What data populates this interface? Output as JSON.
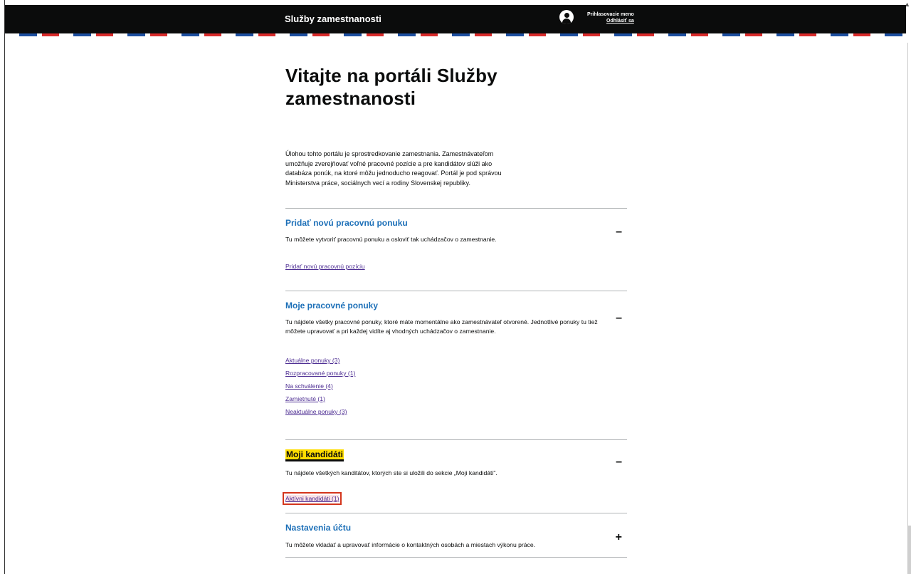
{
  "header": {
    "brand": "Služby zamestnanosti",
    "user_name": "Prihlasovacie meno",
    "logout": "Odhlásiť sa"
  },
  "main": {
    "title": "Vitajte na portáli Služby zamestnanosti",
    "intro": "Úlohou tohto portálu je sprostredkovanie zamestnania. Zamestnávateľom umožňuje zverejňovať voľné pracovné pozície a pre kandidátov slúži ako databáza ponúk, na ktoré môžu jednoducho reagovať. Portál je pod správou Ministerstva práce, sociálnych vecí a rodiny Slovenskej republiky."
  },
  "sections": [
    {
      "title": "Pridať novú pracovnú ponuku",
      "toggle": "–",
      "description": "Tu môžete vytvoriť pracovnú ponuku a osloviť tak uchádzačov o zamestnanie.",
      "links": [
        "Pridať novú pracovnú pozíciu"
      ]
    },
    {
      "title": "Moje pracovné ponuky",
      "toggle": "–",
      "description": "Tu nájdete všetky pracovné ponuky, ktoré máte momentálne ako zamestnávateľ otvorené. Jednotlivé ponuky tu tiež môžete upravovať a pri každej vidíte aj vhodných uchádzačov o zamestnanie.",
      "links": [
        "Aktuálne ponuky (3)",
        "Rozpracované ponuky (1)",
        "Na schválenie (4)",
        "Zamietnuté (1)",
        "Neaktuálne ponuky (3)"
      ]
    },
    {
      "title": "Moji kandidáti",
      "toggle": "–",
      "description": "Tu nájdete všetkých kanditátov, ktorých ste si uložili do sekcie „Moji kandidáti\".",
      "links": [
        "Aktívni kandidáti (1)"
      ]
    },
    {
      "title": "Nastavenia účtu",
      "toggle": "+",
      "description": "Tu môžete vkladať a upravovať informácie o kontaktných osobách a miestach výkonu práce.",
      "links": []
    }
  ],
  "colors": {
    "header_bg": "#0b0c0c",
    "link": "#4c2c92",
    "heading_link": "#1d70b8",
    "highlight": "#ffdd00",
    "focus_outline": "#d4351c"
  }
}
